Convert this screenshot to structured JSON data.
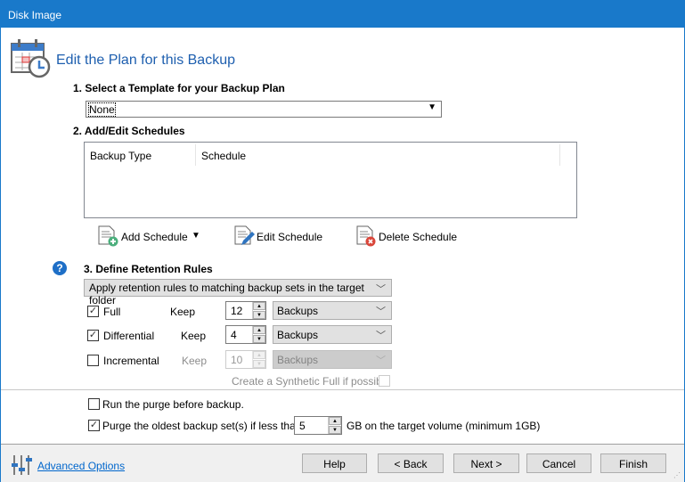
{
  "window": {
    "title": "Disk Image"
  },
  "header": {
    "title": "Edit the Plan for this Backup"
  },
  "step1": {
    "label": "1. Select a Template for your Backup Plan",
    "template_value": "None"
  },
  "step2": {
    "label": "2. Add/Edit Schedules",
    "columns": [
      "Backup Type",
      "Schedule"
    ],
    "add_label": "Add Schedule",
    "edit_label": "Edit Schedule",
    "delete_label": "Delete Schedule"
  },
  "step3": {
    "label": "3. Define Retention Rules",
    "apply_value": "Apply retention rules to matching backup sets in the target folder",
    "rows": [
      {
        "type": "Full",
        "checked": true,
        "keep": "Keep",
        "count": "12",
        "unit": "Backups",
        "enabled": true
      },
      {
        "type": "Differential",
        "checked": true,
        "keep": "Keep",
        "count": "4",
        "unit": "Backups",
        "enabled": true
      },
      {
        "type": "Incremental",
        "checked": false,
        "keep": "Keep",
        "count": "10",
        "unit": "Backups",
        "enabled": false
      }
    ],
    "synthetic_label": "Create a Synthetic Full if possible"
  },
  "options": {
    "run_purge_label": "Run the purge before backup.",
    "run_purge_checked": false,
    "purge_oldest_label": "Purge the oldest backup set(s) if less than",
    "purge_oldest_checked": true,
    "purge_value": "5",
    "purge_suffix": "GB on the target volume (minimum 1GB)"
  },
  "footer": {
    "advanced_label": "Advanced Options",
    "help": "Help",
    "back": "< Back",
    "next": "Next >",
    "cancel": "Cancel",
    "finish": "Finish"
  }
}
